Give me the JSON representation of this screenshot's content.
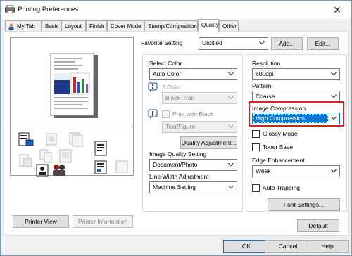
{
  "window": {
    "title": "Printing Preferences",
    "close_glyph": "✕"
  },
  "tabs": [
    {
      "label": "My Tab",
      "icon": "user-icon"
    },
    {
      "label": "Basic"
    },
    {
      "label": "Layout"
    },
    {
      "label": "Finish"
    },
    {
      "label": "Cover Mode"
    },
    {
      "label": "Stamp/Composition"
    },
    {
      "label": "Quality",
      "active": true
    },
    {
      "label": "Other"
    }
  ],
  "favorite": {
    "label": "Favorite Setting",
    "value": "Untitled",
    "add_label": "Add...",
    "edit_label": "Edit..."
  },
  "left": {
    "printer_view_label": "Printer View",
    "printer_information_label": "Printer Information"
  },
  "color": {
    "select_color_label": "Select Color",
    "select_color_value": "Auto Color",
    "two_color_label": "2 Color",
    "two_color_value": "Black+Red",
    "print_with_black_label": "Print with Black",
    "text_figure_value": "Text/Figure",
    "quality_adjustment_label": "Quality Adjustment...",
    "image_quality_label": "Image Quality Setting",
    "image_quality_value": "Document/Photo",
    "line_width_label": "Line Width Adjustment",
    "line_width_value": "Machine Setting"
  },
  "right": {
    "resolution_label": "Resolution",
    "resolution_value": "600dpi",
    "pattern_label": "Pattern",
    "pattern_value": "Coarse",
    "image_compression_label": "Image Compression",
    "image_compression_value": "High Compression",
    "glossy_label": "Glossy Mode",
    "toner_save_label": "Toner Save",
    "edge_label": "Edge Enhancement",
    "edge_value": "Weak",
    "auto_trapping_label": "Auto Trapping",
    "font_settings_label": "Font Settings..."
  },
  "default_label": "Default",
  "footer": {
    "ok_label": "OK",
    "cancel_label": "Cancel",
    "help_label": "Help"
  },
  "colors": {
    "highlight": "#0078d7",
    "highlight_border": "#e02020"
  }
}
